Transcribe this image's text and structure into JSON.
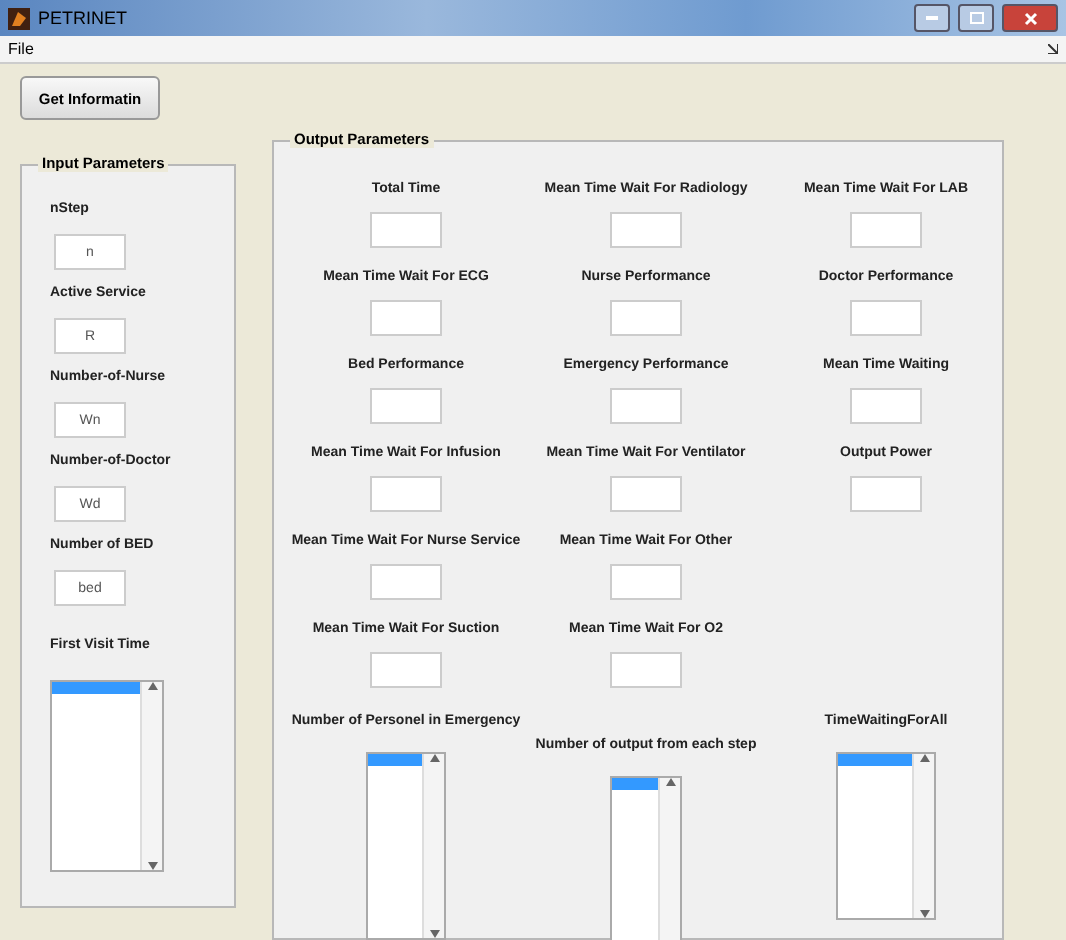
{
  "window": {
    "title": "PETRINET"
  },
  "menu": [
    "File"
  ],
  "get_button": "Get Informatin",
  "input_panel": {
    "title": "Input Parameters",
    "fields": [
      {
        "label": "nStep",
        "value": "n"
      },
      {
        "label": "Active Service",
        "value": "R"
      },
      {
        "label": "Number-of-Nurse",
        "value": "Wn"
      },
      {
        "label": "Number-of-Doctor",
        "value": "Wd"
      },
      {
        "label": "Number of BED",
        "value": "bed"
      }
    ],
    "listbox": {
      "label": "First Visit Time",
      "first_row_selected": true
    }
  },
  "output_panel": {
    "title": "Output Parameters",
    "rows": [
      [
        "Total Time",
        "Mean Time Wait For Radiology",
        "Mean Time Wait For LAB"
      ],
      [
        "Mean Time Wait For ECG",
        "Nurse Performance",
        "Doctor Performance"
      ],
      [
        "Bed Performance",
        "Emergency Performance",
        "Mean Time Waiting"
      ],
      [
        "Mean Time Wait For Infusion",
        "Mean Time Wait For Ventilator",
        "Output Power"
      ],
      [
        "Mean Time Wait For Nurse Service",
        "Mean Time Wait For Other"
      ],
      [
        "Mean Time Wait For Suction",
        "Mean Time Wait For O2"
      ]
    ],
    "listboxes": [
      {
        "label": "Number of Personel in Emergency",
        "first_row_selected": true
      },
      {
        "label": "Number of output from each step",
        "first_row_selected": true
      },
      {
        "label": "TimeWaitingForAll",
        "first_row_selected": true
      }
    ]
  }
}
